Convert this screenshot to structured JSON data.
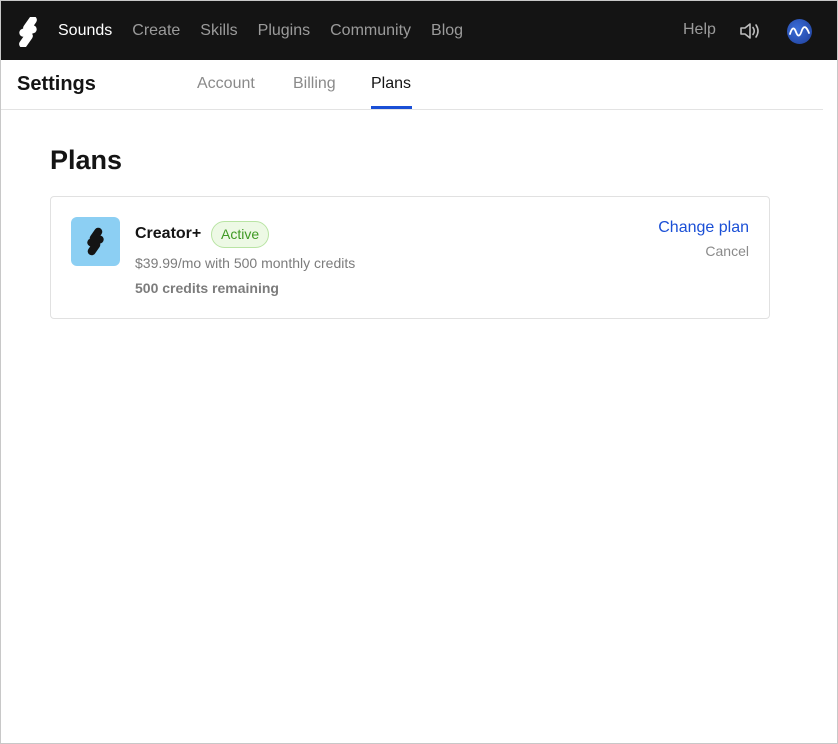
{
  "nav": {
    "items": [
      {
        "label": "Sounds",
        "active": true
      },
      {
        "label": "Create",
        "active": false
      },
      {
        "label": "Skills",
        "active": false
      },
      {
        "label": "Plugins",
        "active": false
      },
      {
        "label": "Community",
        "active": false
      },
      {
        "label": "Blog",
        "active": false
      }
    ],
    "help_label": "Help",
    "icons": {
      "logo": "splice-logo-icon",
      "speaker": "speaker-icon",
      "avatar": "user-avatar"
    }
  },
  "settings": {
    "title": "Settings",
    "tabs": [
      {
        "label": "Account",
        "active": false
      },
      {
        "label": "Billing",
        "active": false
      },
      {
        "label": "Plans",
        "active": true
      }
    ]
  },
  "main": {
    "title": "Plans",
    "plan": {
      "name": "Creator+",
      "status": "Active",
      "description": "$39.99/mo with 500 monthly credits",
      "credits": "500 credits remaining",
      "change_label": "Change plan",
      "cancel_label": "Cancel"
    }
  },
  "colors": {
    "topbar_bg": "#141414",
    "accent": "#1a4fd6",
    "plan_icon_bg": "#8ccff3",
    "active_badge_bg": "#edf9e5",
    "active_badge_text": "#3f9a24"
  }
}
